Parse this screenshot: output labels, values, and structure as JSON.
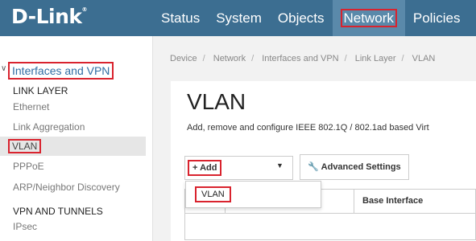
{
  "header": {
    "logo": "D-Link",
    "logo_mark": "®",
    "nav": [
      "Status",
      "System",
      "Objects",
      "Network",
      "Policies"
    ]
  },
  "sidebar": {
    "section_interfaces": "Interfaces and VPN",
    "link_layer_heading": "LINK LAYER",
    "items": [
      "Ethernet",
      "Link Aggregation",
      "VLAN",
      "PPPoE",
      "ARP/Neighbor Discovery"
    ],
    "vpn_heading": "VPN AND TUNNELS",
    "vpn_items": [
      "IPsec"
    ]
  },
  "breadcrumb": [
    "Device",
    "Network",
    "Interfaces and VPN",
    "Link Layer",
    "VLAN"
  ],
  "main": {
    "title": "VLAN",
    "description": "Add, remove and configure IEEE 802.1Q / 802.1ad based Virt",
    "add_label": "Add",
    "advanced_label": "Advanced Settings",
    "table_header_base": "Base Interface"
  },
  "dropdown": {
    "item": "VLAN"
  },
  "colors": {
    "header_bg": "#3c6e91",
    "highlight": "#d9232e",
    "link_blue": "#2f6da3"
  }
}
